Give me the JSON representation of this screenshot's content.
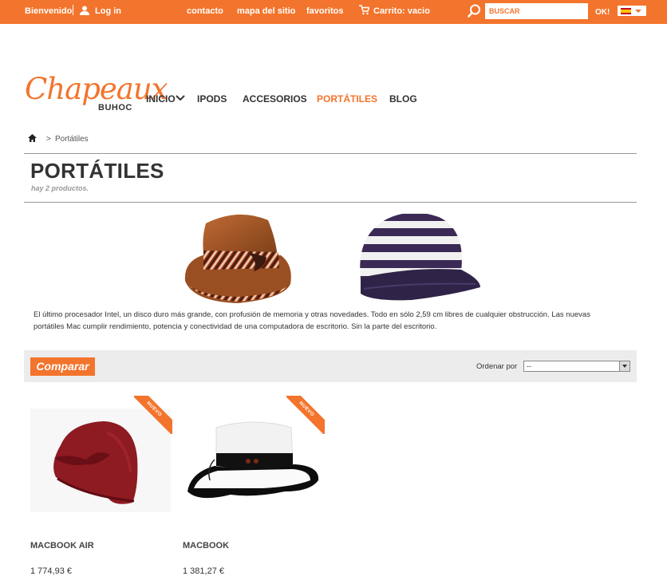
{
  "topbar": {
    "welcome": "Bienvenido",
    "login": "Log in",
    "links": [
      "contacto",
      "mapa del sitio",
      "favoritos"
    ],
    "cart": "Carrito: vacio",
    "search_placeholder": "BUSCAR",
    "search_button": "OK!",
    "bg_color": "#f3742c"
  },
  "header": {
    "logo_main": "Chapeaux",
    "logo_sub": "BUHOC",
    "nav": [
      "INICIO",
      "IPODS",
      "ACCESORIOS",
      "PORTÁTILES",
      "BLOG"
    ],
    "nav_active": "PORTÁTILES"
  },
  "breadcrumb": {
    "separator": ">",
    "current": "Portátiles"
  },
  "category": {
    "title": "PORTÁTILES",
    "count": "hay 2 productos.",
    "description": "El último procesador Intel, un disco duro más grande, con profusión de memoria y otras novedades. Todo en sólo 2,59 cm libres de cualquier obstrucción. Las nuevas portátiles Mac cumplir rendimiento, potencia y conectividad de una computadora de escritorio. Sin la parte del escritorio."
  },
  "toolbar": {
    "compare_label": "Comparar",
    "sort_label": "Ordenar por",
    "sort_value": "--"
  },
  "products": [
    {
      "name": "MACBOOK AIR",
      "price": "1 774,93 €",
      "badge": "NUEVO"
    },
    {
      "name": "MACBOOK",
      "price": "1 381,27 €",
      "badge": "NUEVO"
    }
  ]
}
